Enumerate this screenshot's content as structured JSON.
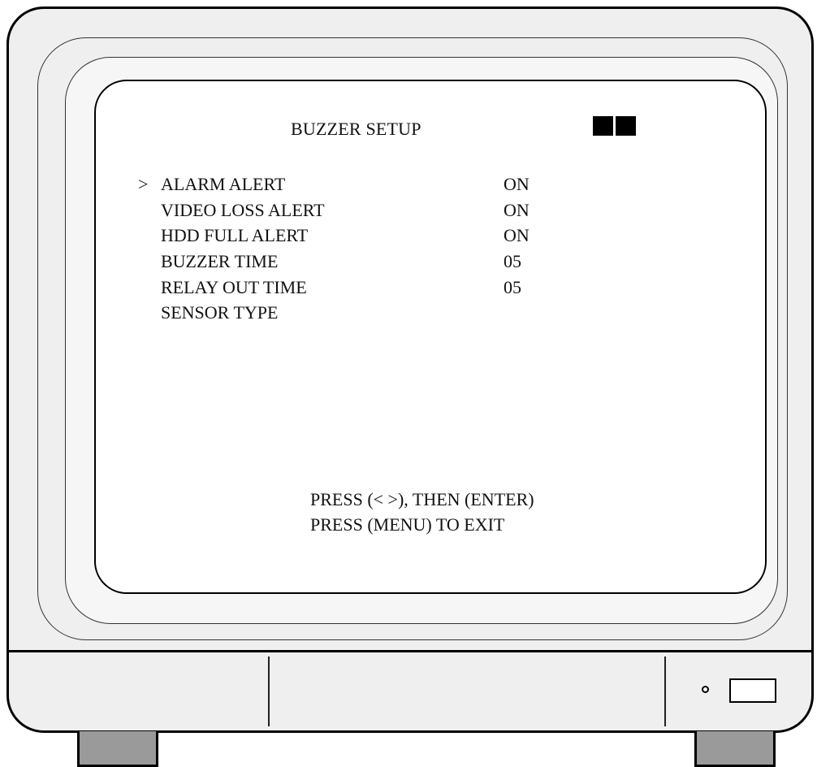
{
  "osd": {
    "title": "BUZZER SETUP",
    "cursor": ">",
    "menu": [
      {
        "label": "ALARM ALERT",
        "value": "ON"
      },
      {
        "label": "VIDEO LOSS ALERT",
        "value": "ON"
      },
      {
        "label": "HDD FULL ALERT",
        "value": "ON"
      },
      {
        "label": "BUZZER TIME",
        "value": "05"
      },
      {
        "label": "RELAY OUT TIME",
        "value": "05"
      },
      {
        "label": "SENSOR TYPE",
        "value": ""
      }
    ],
    "help_line1": "PRESS (< >), THEN (ENTER)",
    "help_line2": "PRESS (MENU) TO EXIT"
  },
  "colors": {
    "osd_text": "#111111",
    "screen_bg": "#ffffff",
    "casing": "#efefef",
    "feet": "#9a9a9a"
  },
  "icons": {
    "status_blocks": "two-black-squares-icon",
    "led": "power-led-icon",
    "power": "power-button-icon"
  }
}
